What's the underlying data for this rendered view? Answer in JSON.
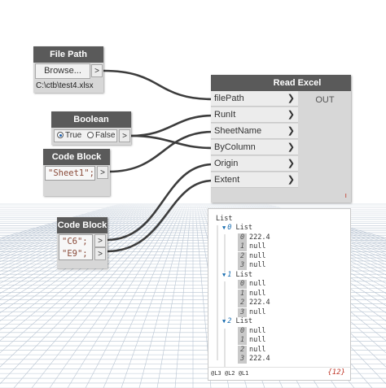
{
  "file_path_node": {
    "title": "File Path",
    "browse_label": "Browse...",
    "out_port": ">",
    "path": "C:\\ctb\\test4.xlsx"
  },
  "boolean_node": {
    "title": "Boolean",
    "true_label": "True",
    "false_label": "False",
    "selected": "True",
    "out_port": ">"
  },
  "code_block_1": {
    "title": "Code Block",
    "code": "\"Sheet1\";",
    "out_port": ">"
  },
  "code_block_2": {
    "title": "Code Block",
    "lines": [
      "\"C6\";",
      "\"E9\";"
    ],
    "out_ports": [
      ">",
      ">"
    ]
  },
  "read_excel_node": {
    "title": "Read Excel",
    "inputs": [
      "filePath",
      "RunIt",
      "SheetName",
      "ByColumn",
      "Origin",
      "Extent"
    ],
    "output": "OUT",
    "status_mark": "ı"
  },
  "watch": {
    "root": "List",
    "lists": [
      {
        "index": "0",
        "label": "List",
        "items": [
          {
            "i": "0",
            "v": "222.4"
          },
          {
            "i": "1",
            "v": "null"
          },
          {
            "i": "2",
            "v": "null"
          },
          {
            "i": "3",
            "v": "null"
          }
        ]
      },
      {
        "index": "1",
        "label": "List",
        "items": [
          {
            "i": "0",
            "v": "null"
          },
          {
            "i": "1",
            "v": "null"
          },
          {
            "i": "2",
            "v": "222.4"
          },
          {
            "i": "3",
            "v": "null"
          }
        ]
      },
      {
        "index": "2",
        "label": "List",
        "items": [
          {
            "i": "0",
            "v": "null"
          },
          {
            "i": "1",
            "v": "null"
          },
          {
            "i": "2",
            "v": "null"
          },
          {
            "i": "3",
            "v": "222.4"
          }
        ]
      }
    ],
    "levels": "@L3 @L2 @L1",
    "count": "{12}"
  },
  "colors": {
    "canvas": "#ffffff",
    "grid": "#b8c4d2",
    "wire": "#3c3c3c",
    "node_header": "#5a5a5a",
    "node_body": "#d7d7d7",
    "index_blue": "#1a6eb0"
  }
}
